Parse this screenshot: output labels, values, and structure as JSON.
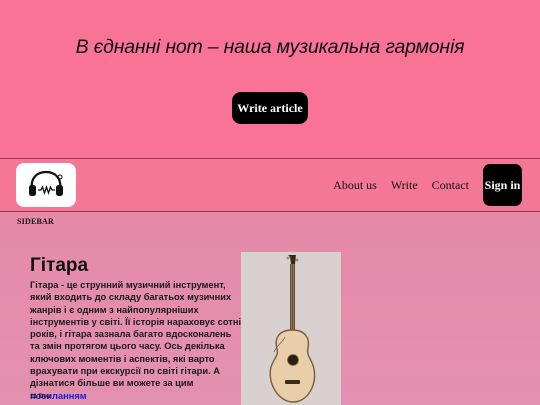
{
  "hero": {
    "title": "В єднанні нот – наша музикальна гармонія",
    "write_button": "Write article"
  },
  "navbar": {
    "logo_icon": "headphones-logo-icon",
    "links": [
      {
        "label": "About us"
      },
      {
        "label": "Write"
      },
      {
        "label": "Contact"
      }
    ],
    "signin_label": "Sign in"
  },
  "sidebar": {
    "label": "SIDEBAR"
  },
  "article": {
    "title": "Гітара",
    "body": "Гітара - це струнний музичний інструмент, який входить до складу багатьох музичних жанрів і є одним з найпопулярніших інструментів у світі. Її історія нараховує сотні років, і гітара зазнала багато вдосконалень та змін протягом цього часу. Ось декілька ключових моментів і аспектів, які варто врахувати при екскурсії по світі гітари. А дізнатися більше ви можете за цим",
    "link_text": "посиланням",
    "date": "11 Dec",
    "image_icon": "guitar-image"
  },
  "colors": {
    "hero_bg": "#f87396",
    "content_bg": "#e58aa8",
    "button_bg": "#000000",
    "link": "#1b1bd9"
  }
}
